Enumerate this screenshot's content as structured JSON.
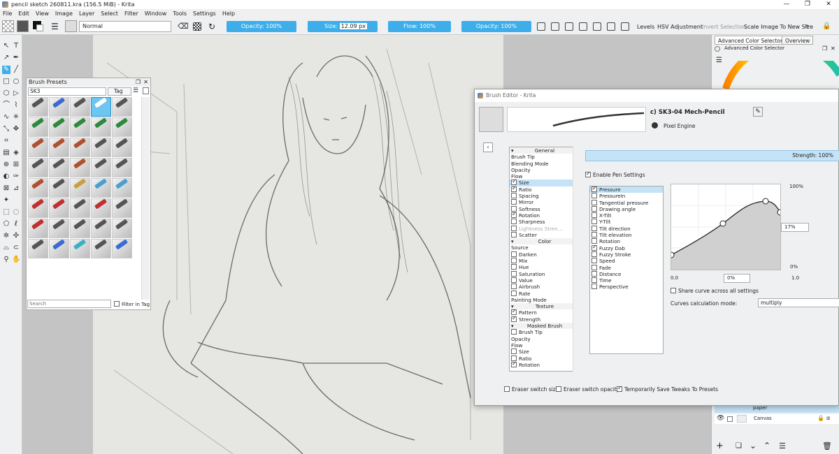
{
  "window": {
    "title": "pencil sketch 260811.kra (156.5 MiB)  -  Krita"
  },
  "menu": [
    "File",
    "Edit",
    "View",
    "Image",
    "Layer",
    "Select",
    "Filter",
    "Window",
    "Tools",
    "Settings",
    "Help"
  ],
  "toolbar": {
    "blend_mode": "Normal",
    "opacity1": "Opacity: 100%",
    "size_label": "Size:",
    "size_value": "12.09 px",
    "flow": "Flow: 100%",
    "opacity2": "Opacity: 100%",
    "levels": "Levels",
    "hsv": "HSV Adjustment",
    "invert": "Invert Selection",
    "scale": "Scale Image To New Size"
  },
  "presets": {
    "title": "Brush Presets",
    "tag_value": "SK3",
    "tag_label": "Tag",
    "search_placeholder": "Search",
    "filter_label": "Filter in Tag"
  },
  "dock": {
    "tab1": "Advanced Color Selector",
    "tab2": "Overview",
    "panel_title": "Advanced Color Selector",
    "layers": [
      {
        "name": "paper"
      },
      {
        "name": "Canvas"
      }
    ]
  },
  "editor": {
    "title": "Brush Editor - Krita",
    "preset_name": "c) SK3-04 Mech-Pencil",
    "engine": "Pixel Engine",
    "strength": "Strength: 100%",
    "enable_pen": "Enable Pen Settings",
    "params": [
      {
        "label": "General",
        "type": "hdr"
      },
      {
        "label": "Brush Tip"
      },
      {
        "label": "Blending Mode"
      },
      {
        "label": "Opacity"
      },
      {
        "label": "Flow"
      },
      {
        "label": "Size",
        "check": true,
        "sel": true
      },
      {
        "label": "Ratio",
        "check": true
      },
      {
        "label": "Spacing",
        "check": false
      },
      {
        "label": "Mirror",
        "check": false
      },
      {
        "label": "Softness",
        "check": false
      },
      {
        "label": "Rotation",
        "check": true
      },
      {
        "label": "Sharpness",
        "check": false
      },
      {
        "label": "Lightness Stren...",
        "check": false,
        "dim": true
      },
      {
        "label": "Scatter",
        "check": false
      },
      {
        "label": "Color",
        "type": "hdr"
      },
      {
        "label": "Source"
      },
      {
        "label": "Darken",
        "check": false
      },
      {
        "label": "Mix",
        "check": false
      },
      {
        "label": "Hue",
        "check": false
      },
      {
        "label": "Saturation",
        "check": false
      },
      {
        "label": "Value",
        "check": false
      },
      {
        "label": "Airbrush",
        "check": false
      },
      {
        "label": "Rate",
        "check": false
      },
      {
        "label": "Painting Mode"
      },
      {
        "label": "Texture",
        "type": "hdr"
      },
      {
        "label": "Pattern",
        "check": true
      },
      {
        "label": "Strength",
        "check": true
      },
      {
        "label": "Masked Brush",
        "type": "hdr"
      },
      {
        "label": "Brush Tip",
        "check": false
      },
      {
        "label": "Opacity"
      },
      {
        "label": "Flow"
      },
      {
        "label": "Size",
        "check": false
      },
      {
        "label": "Ratio",
        "check": false
      },
      {
        "label": "Rotation",
        "check": true
      }
    ],
    "sensors": [
      {
        "label": "Pressure",
        "check": true,
        "sel": true
      },
      {
        "label": "PressureIn",
        "check": false
      },
      {
        "label": "Tangential pressure",
        "check": false
      },
      {
        "label": "Drawing angle",
        "check": false
      },
      {
        "label": "X-Tilt",
        "check": false
      },
      {
        "label": "Y-Tilt",
        "check": false
      },
      {
        "label": "Tilt direction",
        "check": false
      },
      {
        "label": "Tilt elevation",
        "check": false
      },
      {
        "label": "Rotation",
        "check": false
      },
      {
        "label": "Fuzzy Dab",
        "check": true
      },
      {
        "label": "Fuzzy Stroke",
        "check": false
      },
      {
        "label": "Speed",
        "check": false
      },
      {
        "label": "Fade",
        "check": false
      },
      {
        "label": "Distance",
        "check": false
      },
      {
        "label": "Time",
        "check": false
      },
      {
        "label": "Perspective",
        "check": false
      }
    ],
    "curve": {
      "y_max": "100%",
      "y_min": "0%",
      "y_value": "17%",
      "x_min": "0.0",
      "x_value": "0%",
      "x_max": "1.0"
    },
    "share_curve": "Share curve across all settings",
    "calc_mode_label": "Curves calculation mode:",
    "calc_mode_value": "multiply",
    "eraser_size": "Eraser switch size",
    "eraser_opacity": "Eraser switch opacity",
    "temp_save": "Temporarily Save Tweaks To Presets"
  },
  "colors": {
    "accent": "#3daee9",
    "selection": "#c4e3f6"
  }
}
